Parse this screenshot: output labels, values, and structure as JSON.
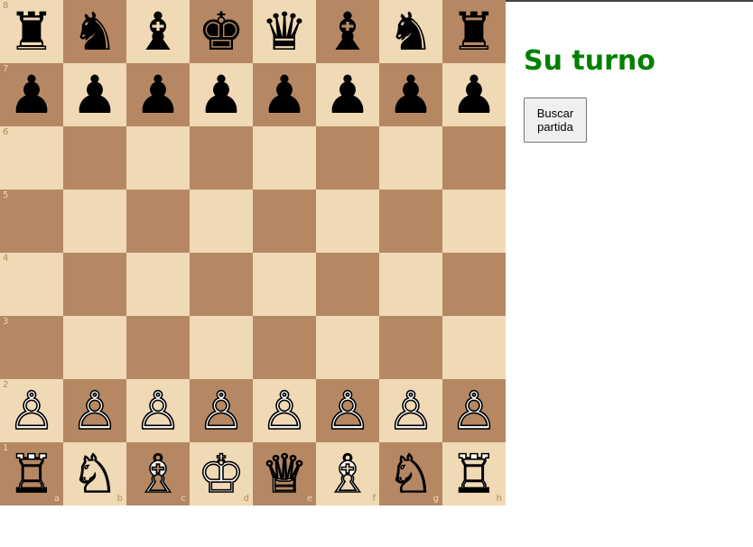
{
  "board": {
    "colors": {
      "light": "#f0d9b5",
      "dark": "#b58863"
    },
    "ranks": [
      "8",
      "7",
      "6",
      "5",
      "4",
      "3",
      "2",
      "1"
    ],
    "files": [
      "a",
      "b",
      "c",
      "d",
      "e",
      "f",
      "g",
      "h"
    ],
    "position": [
      [
        "r",
        "n",
        "b",
        "k",
        "q",
        "b",
        "n",
        "r"
      ],
      [
        "p",
        "p",
        "p",
        "p",
        "p",
        "p",
        "p",
        "p"
      ],
      [
        "",
        "",
        "",
        "",
        "",
        "",
        "",
        ""
      ],
      [
        "",
        "",
        "",
        "",
        "",
        "",
        "",
        ""
      ],
      [
        "",
        "",
        "",
        "",
        "",
        "",
        "",
        ""
      ],
      [
        "",
        "",
        "",
        "",
        "",
        "",
        "",
        ""
      ],
      [
        "P",
        "P",
        "P",
        "P",
        "P",
        "P",
        "P",
        "P"
      ],
      [
        "R",
        "N",
        "B",
        "K",
        "Q",
        "B",
        "N",
        "R"
      ]
    ]
  },
  "piece_glyphs": {
    "k": "♚",
    "q": "♛",
    "r": "♜",
    "b": "♝",
    "n": "♞",
    "p": "♟",
    "K": "♔",
    "Q": "♕",
    "R": "♖",
    "B": "♗",
    "N": "♘",
    "P": "♙"
  },
  "piece_names": {
    "k": "black-king-icon",
    "q": "black-queen-icon",
    "r": "black-rook-icon",
    "b": "black-bishop-icon",
    "n": "black-knight-icon",
    "p": "black-pawn-icon",
    "K": "white-king-icon",
    "Q": "white-queen-icon",
    "R": "white-rook-icon",
    "B": "white-bishop-icon",
    "N": "white-knight-icon",
    "P": "white-pawn-icon"
  },
  "status": {
    "text": "Su turno",
    "color": "#008000"
  },
  "controls": {
    "find_game_label": "Buscar partida"
  }
}
